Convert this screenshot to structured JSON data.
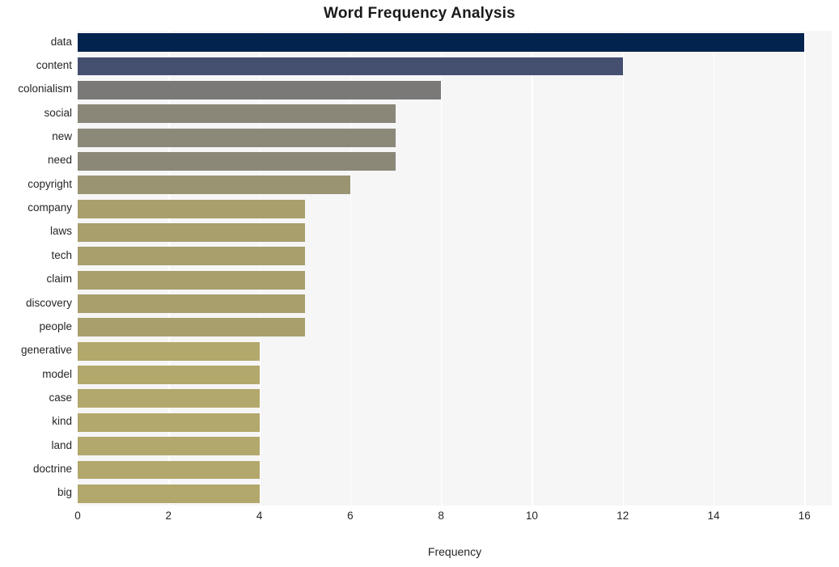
{
  "chart_data": {
    "type": "bar",
    "orientation": "horizontal",
    "title": "Word Frequency Analysis",
    "xlabel": "Frequency",
    "ylabel": "",
    "categories": [
      "data",
      "content",
      "colonialism",
      "social",
      "new",
      "need",
      "copyright",
      "company",
      "laws",
      "tech",
      "claim",
      "discovery",
      "people",
      "generative",
      "model",
      "case",
      "kind",
      "land",
      "doctrine",
      "big"
    ],
    "values": [
      16,
      12,
      8,
      7,
      7,
      7,
      6,
      5,
      5,
      5,
      5,
      5,
      5,
      4,
      4,
      4,
      4,
      4,
      4,
      4
    ],
    "xticks": [
      0,
      2,
      4,
      6,
      8,
      10,
      12,
      14,
      16
    ],
    "xlim": [
      0,
      16.6
    ],
    "grid": "vertical-only",
    "legend": "none",
    "bar_colors": [
      "#03234f",
      "#454f70",
      "#7b7977",
      "#8a8779",
      "#8c8979",
      "#8b8878",
      "#9a9472",
      "#a89f6d",
      "#a89f6d",
      "#a89f6d",
      "#a89f6d",
      "#a89f6d",
      "#a89f6d",
      "#b3a86b",
      "#b3a86b",
      "#b3a86b",
      "#b3a86b",
      "#b3a86b",
      "#b3a86b",
      "#b3a86b"
    ],
    "plot_background": "#f6f6f7",
    "gridline_color": "#ffffff",
    "figure_background": "#ffffff"
  }
}
